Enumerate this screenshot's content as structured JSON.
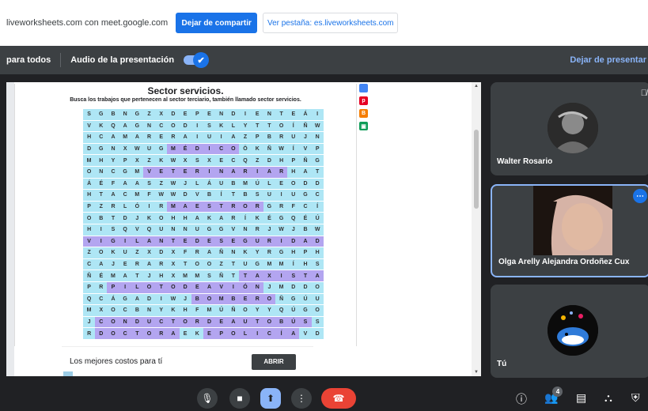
{
  "sharebar": {
    "message": "liveworksheets.com con meet.google.com",
    "stop_label": "Dejar de compartir",
    "view_label": "Ver pestaña: es.liveworksheets.com"
  },
  "presbar": {
    "for_all": "para todos",
    "audio_label": "Audio de la presentación",
    "toggle_check": "✔",
    "stop_presenting": "Dejar de presentar"
  },
  "worksheet": {
    "title": "Sector servicios.",
    "subtitle": "Busca los trabajos que pertenecen al sector terciario, también llamado sector servicios.",
    "rows": [
      "SGBNGZXDEPENDIENTEÁI",
      "VKQAGNCODISKLYTTOÍÑW",
      "HCAMARERAIUIAZPBRUJN",
      "DGNXWUGMÉDICOÖKÑWÍVP",
      "MHYPXZKWXSXECQZDHPÑG",
      "ONCGMVETERINARIARHAT",
      "ÁÉFAASZWJLÁUBMÚLEODD",
      "HTACMFWWDVBÍTBSUIUGC",
      "PZRLÓIRMAESTRORGRFCÍ",
      "OBTDJKOHHAKARÍKÉGQÉÚ",
      "HISQVQUNNUGGVNRJWJBW",
      "VIGILANTEDESEGURIDAD",
      "ZOKUZXDXFRAÑNKYRGHPH",
      "CAJERARXTOOZTUGMMÍHS",
      "ÑÉMATJHXMMSÑTTAXISTA",
      "PRPILOTODEAVIÓNJMDDO",
      "QCÁGADIWJBOMBEROÑGÚU",
      "MXOCBNYKHFMÚÑOYYQÚGO",
      "JCONDUCTORDEAUTOBÚSS",
      "RDOCTORAEKEPOLICÍAVD"
    ],
    "highlights": [
      [
        3,
        7,
        12
      ],
      [
        5,
        5,
        16
      ],
      [
        8,
        7,
        14
      ],
      [
        11,
        0,
        19
      ],
      [
        14,
        13,
        19
      ],
      [
        15,
        2,
        14
      ],
      [
        16,
        9,
        15
      ],
      [
        18,
        1,
        18
      ],
      [
        19,
        1,
        7
      ],
      [
        19,
        10,
        17
      ]
    ],
    "side_icons": [
      {
        "name": "share-icon",
        "color": "#4285f4",
        "glyph": ""
      },
      {
        "name": "pinterest-icon",
        "color": "#e60023",
        "glyph": "p"
      },
      {
        "name": "blogger-icon",
        "color": "#f57d00",
        "glyph": "B"
      },
      {
        "name": "classroom-icon",
        "color": "#0f9d58",
        "glyph": "▣"
      }
    ]
  },
  "ad": {
    "text": "Los mejores costos para tí",
    "button": "ABRIR"
  },
  "participants": [
    {
      "name": "Walter Rosario"
    },
    {
      "name": "Olga Arelly Alejandra Ordoñez Cux"
    },
    {
      "name": "Tú"
    }
  ],
  "controls": {
    "participant_count": "4",
    "icons": [
      "mic-icon",
      "camera-icon",
      "present-icon",
      "more-options-icon",
      "end-call-icon",
      "info-icon",
      "people-icon",
      "chat-icon",
      "activities-icon",
      "host-controls-icon"
    ]
  }
}
